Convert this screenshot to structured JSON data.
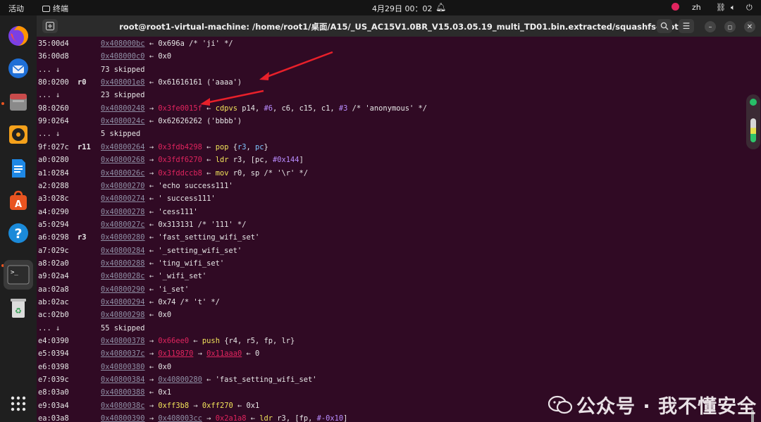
{
  "topbar": {
    "activities": "活动",
    "app_name": "终端",
    "datetime": "4月29日  00：02",
    "lang": "zh"
  },
  "window": {
    "title": "root@root1-virtual-machine: /home/root1/桌面/A15/_US_AC15V1.0BR_V15.03.05.19_multi_TD01.bin.extracted/squashfs-root"
  },
  "terminal": {
    "lines": [
      {
        "off": "35:00d4",
        "reg": "",
        "addr": "0x408000bc",
        "rest": [
          {
            "t": " ← 0x696a /* 'ji' */",
            "c": ""
          }
        ]
      },
      {
        "off": "36:00d8",
        "reg": "",
        "addr": "0x408000c0",
        "rest": [
          {
            "t": " ← 0x0",
            "c": ""
          }
        ]
      },
      {
        "off": "... ↓",
        "reg": "",
        "addr": "",
        "rest": [
          {
            "t": "73 skipped",
            "c": ""
          }
        ]
      },
      {
        "off": "80:0200",
        "reg": "r0",
        "addr": "0x408001e8",
        "rest": [
          {
            "t": " ← 0x61616161 ('aaaa')",
            "c": ""
          }
        ]
      },
      {
        "off": "... ↓",
        "reg": "",
        "addr": "",
        "rest": [
          {
            "t": "23 skipped",
            "c": ""
          }
        ]
      },
      {
        "off": "98:0260",
        "reg": "",
        "addr": "0x40800248",
        "rest": [
          {
            "t": " → ",
            "c": ""
          },
          {
            "t": "0x3fe0015f",
            "c": "red"
          },
          {
            "t": " ← ",
            "c": ""
          },
          {
            "t": "cdpvs",
            "c": "ins"
          },
          {
            "t": " p14, ",
            "c": ""
          },
          {
            "t": "#6",
            "c": "num"
          },
          {
            "t": ", c6, c15, c1, ",
            "c": ""
          },
          {
            "t": "#3",
            "c": "num"
          },
          {
            "t": " /* 'anonymous' */",
            "c": ""
          }
        ]
      },
      {
        "off": "99:0264",
        "reg": "",
        "addr": "0x4080024c",
        "rest": [
          {
            "t": " ← 0x62626262 ('bbbb')",
            "c": ""
          }
        ]
      },
      {
        "off": "... ↓",
        "reg": "",
        "addr": "",
        "rest": [
          {
            "t": "5 skipped",
            "c": ""
          }
        ]
      },
      {
        "off": "9f:027c",
        "reg": "r11",
        "addr": "0x40800264",
        "rest": [
          {
            "t": " → ",
            "c": ""
          },
          {
            "t": "0x3fdb4298",
            "c": "red"
          },
          {
            "t": " ← ",
            "c": ""
          },
          {
            "t": "pop",
            "c": "ins"
          },
          {
            "t": " {",
            "c": ""
          },
          {
            "t": "r3",
            "c": "regname"
          },
          {
            "t": ", ",
            "c": ""
          },
          {
            "t": "pc",
            "c": "regname"
          },
          {
            "t": "}",
            "c": ""
          }
        ]
      },
      {
        "off": "a0:0280",
        "reg": "",
        "addr": "0x40800268",
        "rest": [
          {
            "t": " → ",
            "c": ""
          },
          {
            "t": "0x3fdf6270",
            "c": "red"
          },
          {
            "t": " ← ",
            "c": ""
          },
          {
            "t": "ldr",
            "c": "ins"
          },
          {
            "t": " r3, [pc, ",
            "c": ""
          },
          {
            "t": "#0x144",
            "c": "num"
          },
          {
            "t": "]",
            "c": ""
          }
        ]
      },
      {
        "off": "a1:0284",
        "reg": "",
        "addr": "0x4080026c",
        "rest": [
          {
            "t": " → ",
            "c": ""
          },
          {
            "t": "0x3fddccb8",
            "c": "red"
          },
          {
            "t": " ← ",
            "c": ""
          },
          {
            "t": "mov",
            "c": "ins"
          },
          {
            "t": " r0, sp /* '\\r' */",
            "c": ""
          }
        ]
      },
      {
        "off": "a2:0288",
        "reg": "",
        "addr": "0x40800270",
        "rest": [
          {
            "t": " ← 'echo success111'",
            "c": ""
          }
        ]
      },
      {
        "off": "a3:028c",
        "reg": "",
        "addr": "0x40800274",
        "rest": [
          {
            "t": " ← ' success111'",
            "c": ""
          }
        ]
      },
      {
        "off": "a4:0290",
        "reg": "",
        "addr": "0x40800278",
        "rest": [
          {
            "t": " ← 'cess111'",
            "c": ""
          }
        ]
      },
      {
        "off": "a5:0294",
        "reg": "",
        "addr": "0x4080027c",
        "rest": [
          {
            "t": " ← 0x313131 /* '111' */",
            "c": ""
          }
        ]
      },
      {
        "off": "a6:0298",
        "reg": "r3",
        "addr": "0x40800280",
        "rest": [
          {
            "t": " ← 'fast_setting_wifi_set'",
            "c": ""
          }
        ]
      },
      {
        "off": "a7:029c",
        "reg": "",
        "addr": "0x40800284",
        "rest": [
          {
            "t": " ← '_setting_wifi_set'",
            "c": ""
          }
        ]
      },
      {
        "off": "a8:02a0",
        "reg": "",
        "addr": "0x40800288",
        "rest": [
          {
            "t": " ← 'ting_wifi_set'",
            "c": ""
          }
        ]
      },
      {
        "off": "a9:02a4",
        "reg": "",
        "addr": "0x4080028c",
        "rest": [
          {
            "t": " ← '_wifi_set'",
            "c": ""
          }
        ]
      },
      {
        "off": "aa:02a8",
        "reg": "",
        "addr": "0x40800290",
        "rest": [
          {
            "t": " ← 'i_set'",
            "c": ""
          }
        ]
      },
      {
        "off": "ab:02ac",
        "reg": "",
        "addr": "0x40800294",
        "rest": [
          {
            "t": " ← 0x74 /* 't' */",
            "c": ""
          }
        ]
      },
      {
        "off": "ac:02b0",
        "reg": "",
        "addr": "0x40800298",
        "rest": [
          {
            "t": " ← 0x0",
            "c": ""
          }
        ]
      },
      {
        "off": "... ↓",
        "reg": "",
        "addr": "",
        "rest": [
          {
            "t": "55 skipped",
            "c": ""
          }
        ]
      },
      {
        "off": "e4:0390",
        "reg": "",
        "addr": "0x40800378",
        "rest": [
          {
            "t": " → ",
            "c": ""
          },
          {
            "t": "0x66ee0",
            "c": "red"
          },
          {
            "t": " ← ",
            "c": ""
          },
          {
            "t": "push",
            "c": "ins"
          },
          {
            "t": " {r4, r5, fp, lr}",
            "c": ""
          }
        ]
      },
      {
        "off": "e5:0394",
        "reg": "",
        "addr": "0x4080037c",
        "rest": [
          {
            "t": " → ",
            "c": ""
          },
          {
            "t": "0x119870",
            "c": "redu"
          },
          {
            "t": " → ",
            "c": ""
          },
          {
            "t": "0x11aaa0",
            "c": "redu"
          },
          {
            "t": " ← 0",
            "c": ""
          }
        ]
      },
      {
        "off": "e6:0398",
        "reg": "",
        "addr": "0x40800380",
        "rest": [
          {
            "t": " ← 0x0",
            "c": ""
          }
        ]
      },
      {
        "off": "e7:039c",
        "reg": "",
        "addr": "0x40800384",
        "rest": [
          {
            "t": " → ",
            "c": ""
          },
          {
            "t": "0x40800280",
            "c": "addrc"
          },
          {
            "t": " ← 'fast_setting_wifi_set'",
            "c": ""
          }
        ]
      },
      {
        "off": "e8:03a0",
        "reg": "",
        "addr": "0x40800388",
        "rest": [
          {
            "t": " ← 0x1",
            "c": ""
          }
        ]
      },
      {
        "off": "e9:03a4",
        "reg": "",
        "addr": "0x4080038c",
        "rest": [
          {
            "t": " → ",
            "c": ""
          },
          {
            "t": "0xff3b8",
            "c": "ins"
          },
          {
            "t": " → ",
            "c": ""
          },
          {
            "t": "0xff270",
            "c": "ins"
          },
          {
            "t": " ← 0x1",
            "c": ""
          }
        ]
      },
      {
        "off": "ea:03a8",
        "reg": "",
        "addr": "0x40800390",
        "rest": [
          {
            "t": " → ",
            "c": ""
          },
          {
            "t": "0x408003cc",
            "c": "addrc"
          },
          {
            "t": " → ",
            "c": ""
          },
          {
            "t": "0x2a1a8",
            "c": "red"
          },
          {
            "t": " ← ",
            "c": ""
          },
          {
            "t": "ldr",
            "c": "ins"
          },
          {
            "t": " r3, [fp, ",
            "c": ""
          },
          {
            "t": "#-0x10",
            "c": "num"
          },
          {
            "t": "]",
            "c": ""
          }
        ]
      }
    ]
  },
  "watermark": "公众号 · 我不懂安全",
  "dock": {
    "icons": [
      "firefox-icon",
      "thunderbird-icon",
      "files-icon",
      "rhythmbox-icon",
      "writer-icon",
      "app-center-icon",
      "help-icon",
      "terminal-icon",
      "trash-icon",
      "show-apps-icon"
    ]
  },
  "colors": {
    "terminal_bg": "#300a24",
    "accent": "#e95420",
    "pointer_red": "#e0245e",
    "instruction_yellow": "#f1e35a"
  }
}
